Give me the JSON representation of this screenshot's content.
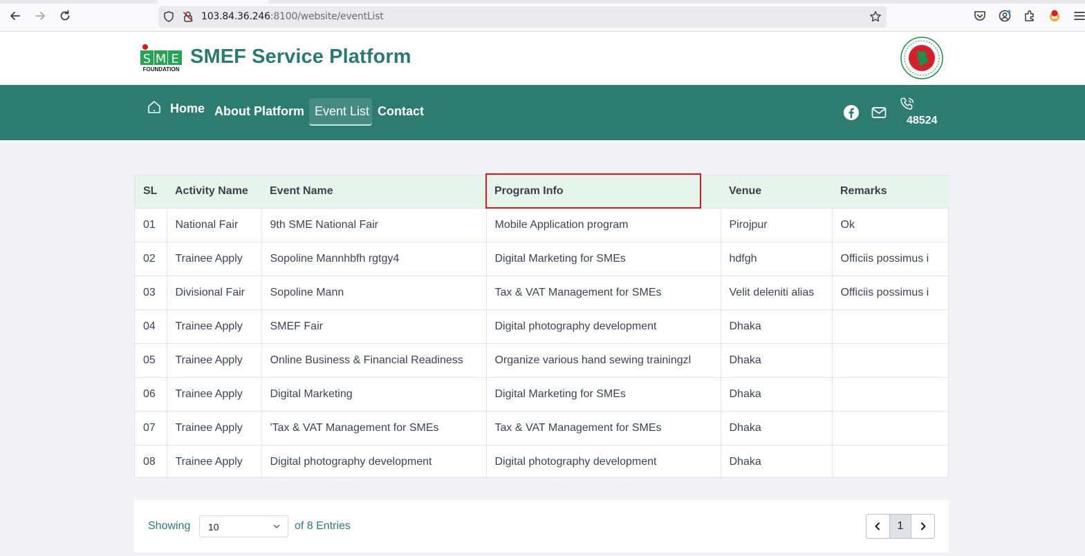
{
  "browser": {
    "url_host": "103.84.36.246",
    "url_rest": ":8100/website/eventList"
  },
  "site": {
    "title": "SMEF Service Platform",
    "logo_text": "SME",
    "logo_sub": "FOUNDATION"
  },
  "nav": {
    "items": [
      {
        "label": "Home"
      },
      {
        "label": "About Platform"
      },
      {
        "label": "Event List"
      },
      {
        "label": "Contact"
      }
    ],
    "phone": "48524"
  },
  "table": {
    "headers": [
      "SL",
      "Activity Name",
      "Event Name",
      "Program Info",
      "Venue",
      "Remarks"
    ],
    "rows": [
      [
        "01",
        "National Fair",
        "9th SME National Fair",
        "Mobile Application program",
        "Pirojpur",
        "Ok"
      ],
      [
        "02",
        "Trainee Apply",
        "Sopoline Mannhbfh rgtgy4",
        "Digital Marketing for SMEs",
        "hdfgh",
        "Officiis possimus i"
      ],
      [
        "03",
        "Divisional Fair",
        "Sopoline Mann",
        "Tax & VAT Management for SMEs",
        "Velit deleniti alias",
        "Officiis possimus i"
      ],
      [
        "04",
        "Trainee Apply",
        "SMEF Fair",
        "Digital photography development",
        "Dhaka",
        ""
      ],
      [
        "05",
        "Trainee Apply",
        "Online Business & Financial Readiness",
        "Organize various hand sewing trainingzl",
        "Dhaka",
        ""
      ],
      [
        "06",
        "Trainee Apply",
        "Digital Marketing",
        "Digital Marketing for SMEs",
        "Dhaka",
        ""
      ],
      [
        "07",
        "Trainee Apply",
        "'Tax & VAT Management for SMEs",
        "Tax & VAT Management for SMEs",
        "Dhaka",
        ""
      ],
      [
        "08",
        "Trainee Apply",
        "Digital photography development",
        "Digital photography development",
        "Dhaka",
        ""
      ]
    ]
  },
  "pagination": {
    "showing_label": "Showing",
    "page_size": "10",
    "entries_label": "of 8 Entries",
    "current_page": "1"
  },
  "colors": {
    "brand": "#2c7c70",
    "header_row": "#e6f5ec",
    "highlight": "#e0141d"
  }
}
